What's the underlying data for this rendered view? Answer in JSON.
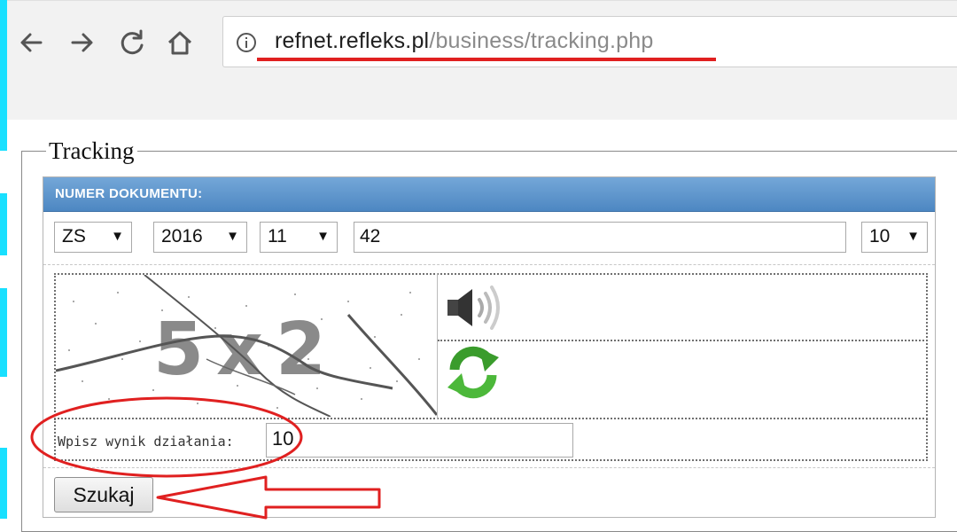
{
  "browser": {
    "nav": {
      "back_icon": "arrow-left-icon",
      "forward_icon": "arrow-right-icon",
      "reload_icon": "reload-icon",
      "home_icon": "home-icon"
    },
    "url_host": "refnet.refleks.pl",
    "url_path": "/business/tracking.php"
  },
  "fieldset": {
    "legend": "Tracking"
  },
  "form": {
    "header": "NUMER DOKUMENTU:",
    "doc_type": "ZS",
    "year": "2016",
    "month": "11",
    "doc_number": "42",
    "branch": "10",
    "captcha": {
      "audio_icon": "speaker-icon",
      "refresh_icon": "refresh-icon",
      "answer_label": "Wpisz wynik działania:",
      "answer_value": "10"
    },
    "submit_label": "Szukaj"
  },
  "colors": {
    "header_blue": "#5b94cc",
    "annotation_red": "#e02020",
    "deco_cyan": "#19e0ff"
  }
}
